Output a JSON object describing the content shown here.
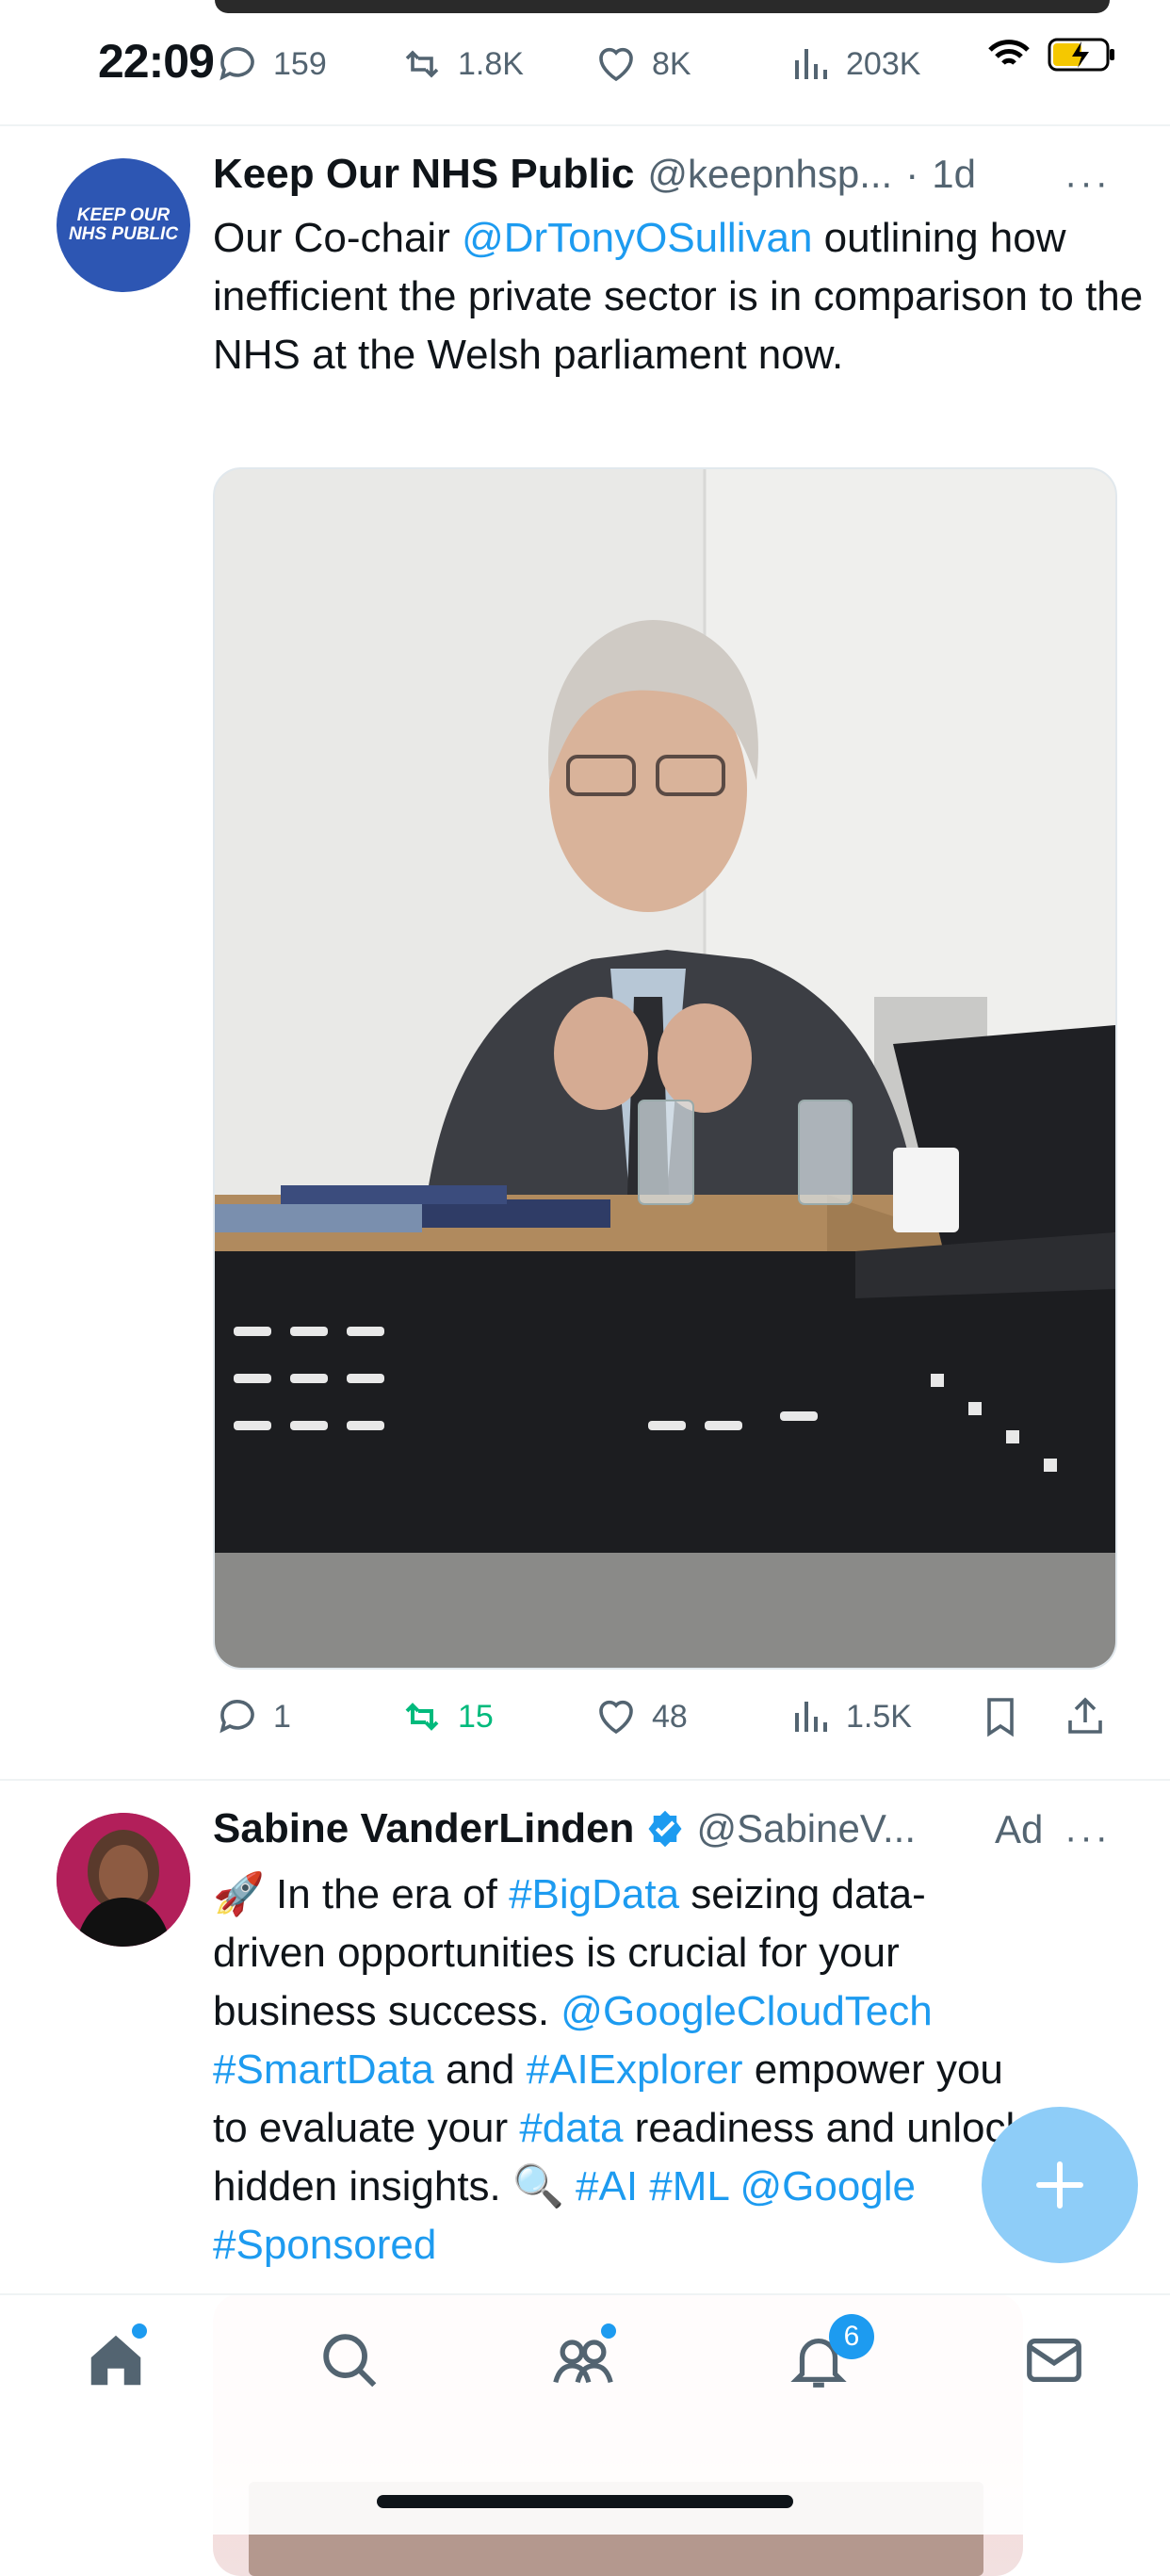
{
  "status_bar": {
    "time": "22:09"
  },
  "prev_tweet": {
    "actions": {
      "replies": "159",
      "reposts": "1.8K",
      "likes": "8K",
      "views": "203K"
    }
  },
  "tweet1": {
    "name": "Keep Our NHS Public",
    "handle": "@keepnhsp...",
    "separator": "·",
    "time": "1d",
    "avatar_text": "KEEP OUR NHS PUBLIC",
    "text_parts": [
      {
        "text": "Our Co-chair ",
        "link": false
      },
      {
        "text": "@DrTonyOSullivan",
        "link": true
      },
      {
        "text": " outlining how inefficient the private sector is in comparison to the NHS at the Welsh parliament now.",
        "link": false
      }
    ],
    "actions": {
      "replies": "1",
      "reposts": "15",
      "likes": "48",
      "views": "1.5K"
    },
    "repost_color": "#00ba7c"
  },
  "tweet2": {
    "name": "Sabine VanderLinden",
    "handle": "@SabineV...",
    "ad_label": "Ad",
    "text": {
      "l1_pre": "🚀 In the era of ",
      "l1_tag": "#BigData",
      "l1_post": " seizing data-",
      "l2": "driven opportunities is crucial for your",
      "l3_pre": "business success. ",
      "l3_tag": "@GoogleCloudTech",
      "l4_tag1": "#SmartData",
      "l4_mid": " and ",
      "l4_tag2": "#AIExplorer",
      "l4_post": " empower you",
      "l5_pre": "to evaluate your ",
      "l5_tag": "#data",
      "l5_post": " readiness and unlock",
      "l6_pre": "hidden insights. 🔍 ",
      "l6_tags": "#AI #ML @Google",
      "l7_tag": "#Sponsored"
    }
  },
  "bottom_nav": {
    "items": [
      "home",
      "search",
      "communities",
      "notifications",
      "messages"
    ],
    "notifications_badge": "6"
  },
  "colors": {
    "accent": "#1d9bf0",
    "text": "#0f1419",
    "muted": "#536471"
  }
}
